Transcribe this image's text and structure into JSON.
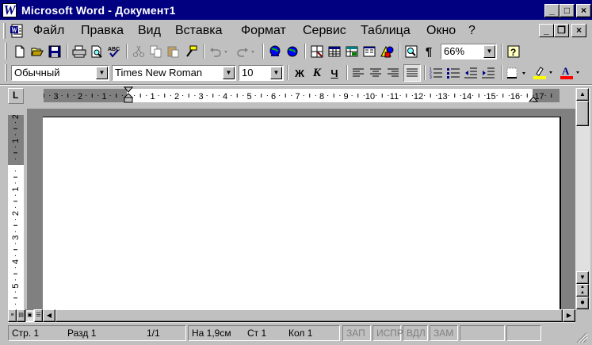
{
  "window": {
    "title": "Microsoft Word - Документ1",
    "app_icon_letter": "W",
    "minimize": "_",
    "maximize": "□",
    "close": "×"
  },
  "menu": {
    "items": [
      "Файл",
      "Правка",
      "Вид",
      "Вставка",
      "Формат",
      "Сервис",
      "Таблица",
      "Окно",
      "?"
    ],
    "mdi_minimize": "_",
    "mdi_restore": "❐",
    "mdi_close": "×"
  },
  "standard_toolbar": {
    "zoom": "66%",
    "buttons": [
      "new-icon",
      "open-icon",
      "save-icon",
      "print-icon",
      "print-preview-icon",
      "spelling-icon",
      "cut-icon",
      "copy-icon",
      "paste-icon",
      "format-painter-icon",
      "undo-icon",
      "redo-icon",
      "hyperlink-icon",
      "web-toolbar-icon",
      "tables-borders-icon",
      "insert-table-icon",
      "insert-excel-icon",
      "columns-icon",
      "drawing-icon",
      "document-map-icon",
      "show-formatting-icon",
      "help-icon"
    ]
  },
  "formatting_toolbar": {
    "style": "Обычный",
    "font": "Times New Roman",
    "size": "10",
    "bold": "Ж",
    "italic": "К",
    "underline": "Ч"
  },
  "ruler": {
    "h_labels": [
      "3",
      "2",
      "1",
      "1",
      "2",
      "3",
      "4",
      "5",
      "6",
      "7",
      "8",
      "9",
      "10",
      "11",
      "12",
      "13",
      "14",
      "15",
      "16",
      "17"
    ],
    "v_labels": [
      "2",
      "1",
      "1",
      "2",
      "3",
      "4",
      "5"
    ],
    "tab_stop": "L"
  },
  "status": {
    "page": "Стр. 1",
    "section": "Разд 1",
    "pages": "1/1",
    "at": "На 1,9см",
    "line": "Ст 1",
    "col": "Кол 1",
    "rec": "ЗАП",
    "trk": "ИСПР",
    "ext": "ВДЛ",
    "ovr": "ЗАМ"
  },
  "colors": {
    "titlebar": "#000080",
    "face": "#c0c0c0",
    "highlight": "#ffff00",
    "font_color": "#ff0000"
  }
}
